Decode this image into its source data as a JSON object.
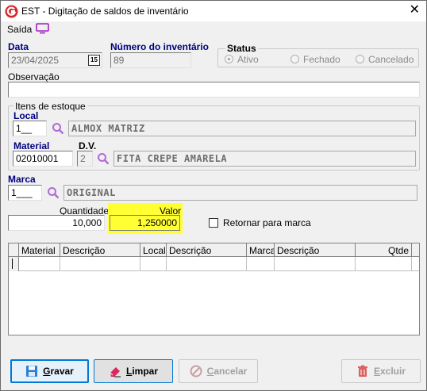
{
  "window": {
    "title": "EST - Digitação de saldos de inventário",
    "close_glyph": "✕"
  },
  "menu": {
    "saida": "Saída"
  },
  "header": {
    "data_label": "Data",
    "data_value": "23/04/2025",
    "calendar_glyph": "15",
    "numero_label": "Número do inventário",
    "numero_value": "89",
    "status_label": "Status",
    "status_options": [
      "Ativo",
      "Fechado",
      "Cancelado"
    ],
    "status_selected": "Ativo",
    "observacao_label": "Observação",
    "observacao_value": ""
  },
  "itens": {
    "group_label": "Itens de estoque",
    "local_label": "Local",
    "local_code": "1__",
    "local_desc": "ALMOX MATRIZ",
    "material_label": "Material",
    "material_code": "02010001",
    "dv_label": "D.V.",
    "dv_value": "2",
    "material_desc": "FITA CREPE AMARELA"
  },
  "marca": {
    "label": "Marca",
    "code": "1___",
    "desc": "ORIGINAL"
  },
  "quantidade": {
    "label": "Quantidade",
    "value": "10,000"
  },
  "valor": {
    "label": "Valor",
    "value": "1,250000"
  },
  "retornar": {
    "label": "Retornar para marca",
    "checked": false
  },
  "grid": {
    "columns": [
      "",
      "Material",
      "Descrição",
      "Local",
      "Descrição",
      "Marca",
      "Descrição",
      "Qtde"
    ]
  },
  "buttons": {
    "gravar_first": "G",
    "gravar_rest": "ravar",
    "limpar_first": "L",
    "limpar_rest": "impar",
    "cancelar_first": "C",
    "cancelar_rest": "ancelar",
    "excluir_first": "E",
    "excluir_rest": "xcluir"
  },
  "colors": {
    "accent": "#0078d7",
    "label_blue": "#000080",
    "highlight_yellow": "#ffff33",
    "icon_purple": "#b06bd6",
    "app_red": "#d9262b"
  }
}
